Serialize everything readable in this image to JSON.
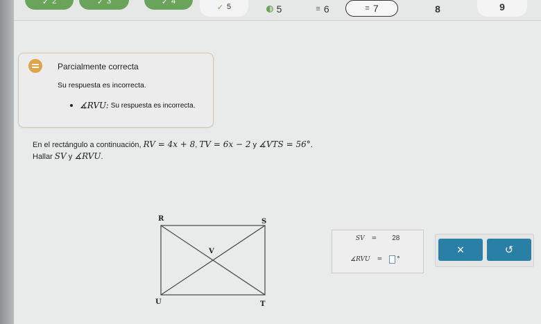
{
  "progress": {
    "steps": [
      {
        "label": "2",
        "state": "done"
      },
      {
        "label": "3",
        "state": "done"
      },
      {
        "label": "4",
        "state": "done"
      },
      {
        "label": "5",
        "state": "partial"
      },
      {
        "label": "6",
        "state": "flag"
      },
      {
        "label": "7",
        "state": "current"
      },
      {
        "label": "8",
        "state": "plain"
      },
      {
        "label": "9",
        "state": "plain"
      }
    ]
  },
  "feedback": {
    "title": "Parcialmente correcta",
    "subtitle": "Su respuesta es incorrecta.",
    "item_label": "∡RVU:",
    "item_text": "Su respuesta es incorrecta."
  },
  "problem": {
    "line1_prefix": "En el rectángulo a continuación, ",
    "eq1": "RV = 4x + 8",
    "sep1": ", ",
    "eq2": "TV = 6x − 2",
    "sep2": " y ",
    "eq3": "∡VTS = 56°",
    "end1": ".",
    "line2_prefix": "Hallar ",
    "q1": "SV",
    "line2_mid": " y ",
    "q2": "∡RVU",
    "end2": "."
  },
  "diagram": {
    "labels": {
      "R": "R",
      "S": "S",
      "U": "U",
      "T": "T",
      "V": "V"
    }
  },
  "answer": {
    "row1_label": "SV",
    "row1_eq": "=",
    "row1_value": "28",
    "row2_label": "∡RVU",
    "row2_eq": "=",
    "row2_value": "",
    "degree_symbol": "°"
  },
  "controls": {
    "clear_label": "×",
    "undo_label": "↺"
  },
  "colors": {
    "done": "#6aa35a",
    "warning": "#e0a347",
    "button": "#2a7fa6"
  }
}
